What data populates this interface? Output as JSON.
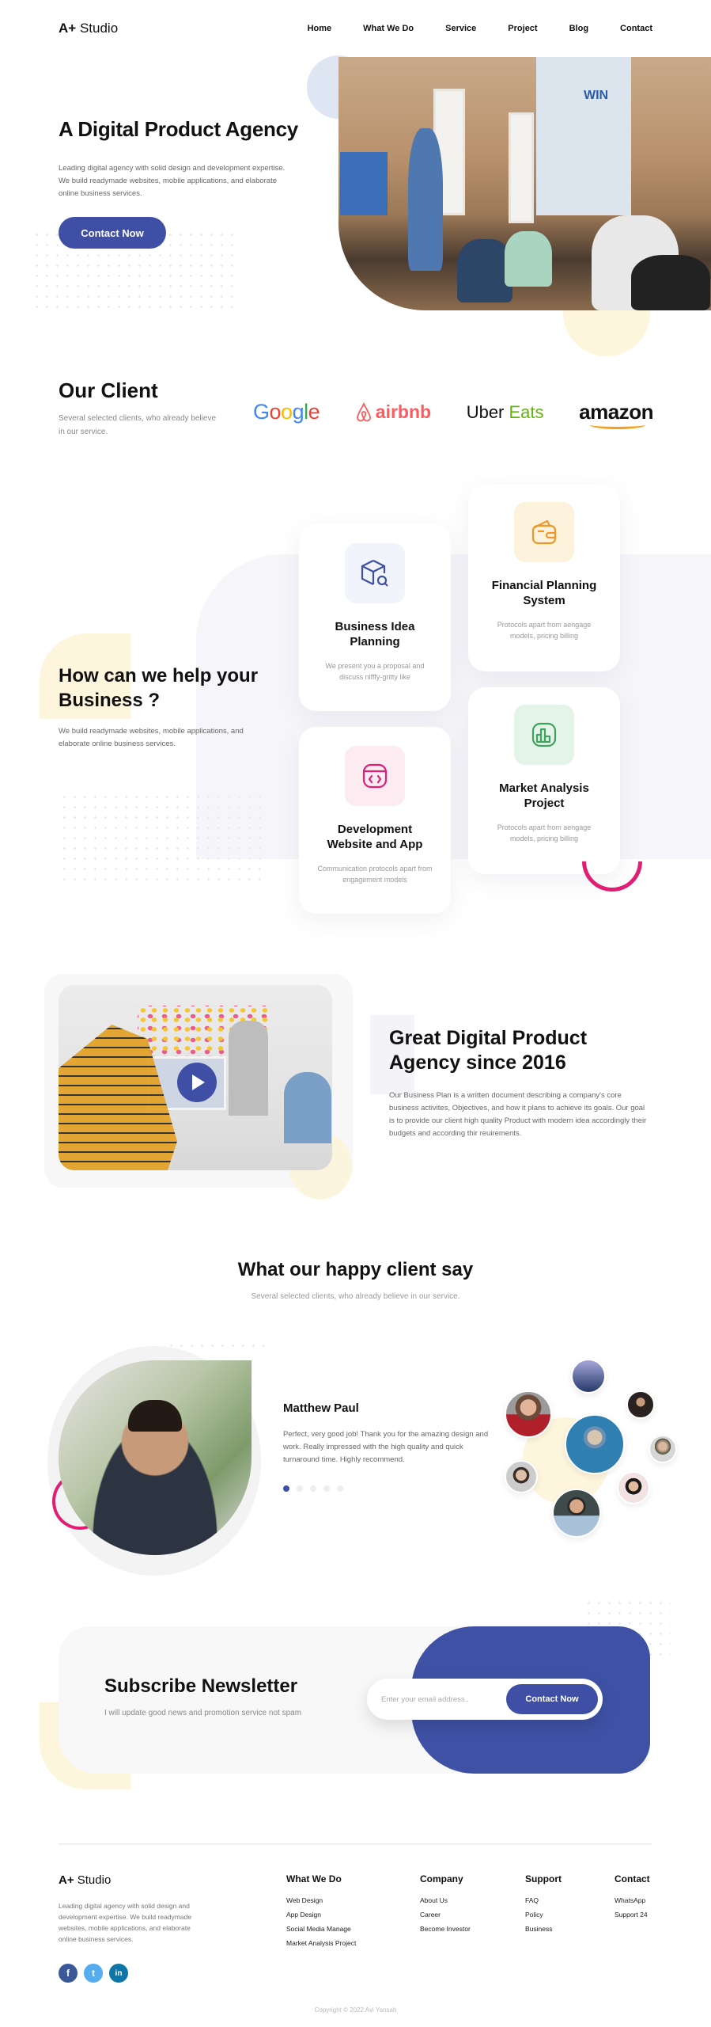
{
  "brand": {
    "logo_bold": "A+",
    "logo_rest": " Studio"
  },
  "colors": {
    "primary": "#3f4fa5",
    "accent_pink": "#e11d74",
    "accent_yellow": "#fdf5dc"
  },
  "nav": {
    "items": [
      "Home",
      "What We Do",
      "Service",
      "Project",
      "Blog",
      "Contact"
    ]
  },
  "hero": {
    "title": "A Digital Product Agency",
    "description": "Leading digital agency with solid design and development expertise. We build readymade websites, mobile applications, and elaborate online business services.",
    "cta": "Contact Now",
    "image_label": "WIN"
  },
  "clients": {
    "title": "Our Client",
    "description": "Several selected clients, who already believe in our service.",
    "logos": [
      {
        "name": "Google",
        "text": "Google"
      },
      {
        "name": "airbnb",
        "text": "airbnb"
      },
      {
        "name": "Uber Eats",
        "text_a": "Uber",
        "text_b": " Eats"
      },
      {
        "name": "amazon",
        "text": "amazon"
      }
    ]
  },
  "services": {
    "title": "How can we help your Business ?",
    "description": "We build readymade websites, mobile applications, and elaborate online business services.",
    "cards": [
      {
        "title": "Business Idea Planning",
        "text": "We present you a proposal and discuss nifffy-gritty like",
        "icon": "box-search-icon",
        "color": "#3f4fa5",
        "bg": "#f1f4fb"
      },
      {
        "title": "Financial Planning System",
        "text": "Protocols apart from aengage models, pricing billing",
        "icon": "wallet-icon",
        "color": "#f0962b",
        "bg": "#fdf3dc"
      },
      {
        "title": "Development Website and App",
        "text": "Communication protocols apart from engagement models",
        "icon": "code-window-icon",
        "color": "#e11d74",
        "bg": "#fcecf2"
      },
      {
        "title": "Market Analysis Project",
        "text": "Protocols apart from aengage models, pricing billing",
        "icon": "chart-icon",
        "color": "#3da35d",
        "bg": "#e4f4e9"
      }
    ]
  },
  "about": {
    "title": "Great Digital Product Agency since 2016",
    "description": "Our Business Plan is a written document describing a company's core business activites, Objectives, and how it plans to achieve its goals. Our goal is to provide our client high quality Product with modern idea accordingly their budgets and according thir reuirements."
  },
  "testimonials": {
    "title": "What our happy client say",
    "subtitle": "Several selected clients, who already believe in our service.",
    "name": "Matthew Paul",
    "quote": "Perfect, very good job! Thank you for the amazing design and work. Really impressed with the high quality and quick turnaround time. Highly recommend.",
    "pages": 5,
    "active_page": 1
  },
  "newsletter": {
    "title": "Subscribe Newsletter",
    "subtitle": "I will update good news and promotion service not spam",
    "placeholder": "Enter your email address..",
    "button": "Contact Now"
  },
  "footer": {
    "logo_bold": "A+",
    "logo_rest": " Studio",
    "description": "Leading digital agency with solid design and development expertise. We build readymade websites, mobile applications, and elaborate online business services.",
    "social": [
      "facebook",
      "twitter",
      "linkedin"
    ],
    "columns": [
      {
        "title": "What We Do",
        "links": [
          "Web Design",
          "App Design",
          "Social Media Manage",
          "Market Analysis Project"
        ]
      },
      {
        "title": "Company",
        "links": [
          "About Us",
          "Career",
          "Become Investor"
        ]
      },
      {
        "title": "Support",
        "links": [
          "FAQ",
          "Policy",
          "Business"
        ]
      },
      {
        "title": "Contact",
        "links": [
          "WhatsApp",
          "Support 24"
        ]
      }
    ],
    "copyright": "Copyright © 2022 Avi Yansah"
  }
}
